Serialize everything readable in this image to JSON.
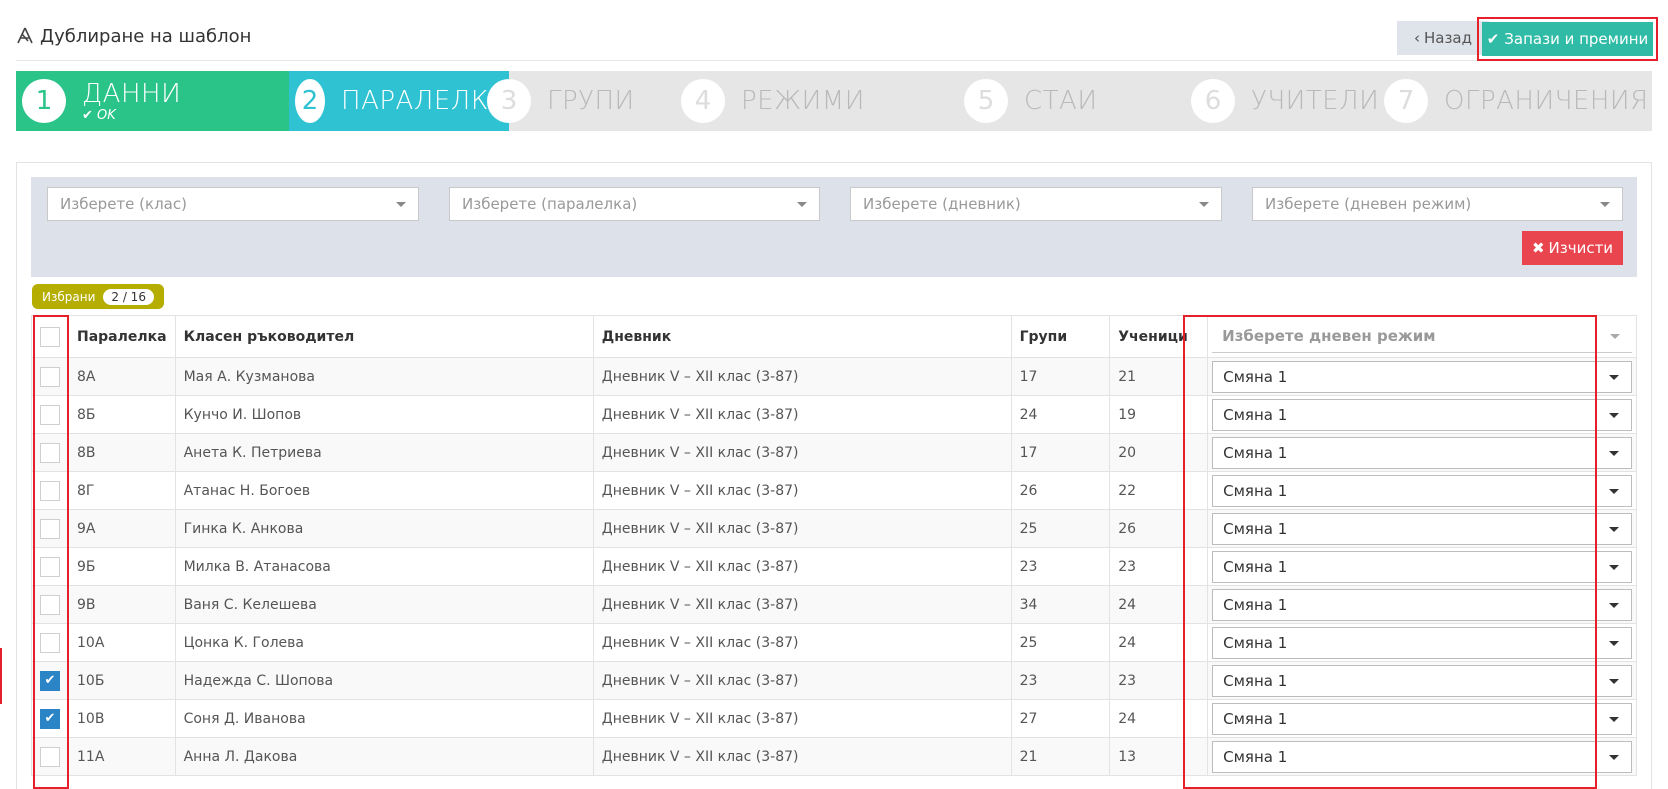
{
  "header": {
    "title": "Дублиране на шаблон",
    "back_label": "Назад",
    "save_label": "Запази и премини"
  },
  "wizard": {
    "steps": [
      {
        "number": "1",
        "label": "ДАННИ",
        "sub": "OK",
        "state": "done"
      },
      {
        "number": "2",
        "label": "ПАРАЛЕЛКИ",
        "state": "active"
      },
      {
        "number": "3",
        "label": "ГРУПИ",
        "state": "pending"
      },
      {
        "number": "4",
        "label": "РЕЖИМИ",
        "state": "pending"
      },
      {
        "number": "5",
        "label": "СТАИ",
        "state": "pending"
      },
      {
        "number": "6",
        "label": "УЧИТЕЛИ",
        "state": "pending"
      },
      {
        "number": "7",
        "label": "ОГРАНИЧЕНИЯ",
        "state": "pending"
      }
    ]
  },
  "filters": {
    "class_placeholder": "Изберете (клас)",
    "paralelka_placeholder": "Изберете (паралелка)",
    "diary_placeholder": "Изберете (дневник)",
    "mode_placeholder": "Изберете (дневен режим)",
    "clear_label": "Изчисти"
  },
  "selection": {
    "label": "Избрани",
    "count": "2 / 16"
  },
  "table": {
    "columns": [
      "Паралелка",
      "Класен ръководител",
      "Дневник",
      "Групи",
      "Ученици"
    ],
    "mode_header_placeholder": "Изберете дневен режим",
    "rows": [
      {
        "paralelka": "8А",
        "teacher": "Мая А. Кузманова",
        "diary": "Дневник V – XII клас (3-87)",
        "groups": "17",
        "students": "21",
        "mode": "Смяна 1",
        "checked": false
      },
      {
        "paralelka": "8Б",
        "teacher": "Кунчо И. Шопов",
        "diary": "Дневник V – XII клас (3-87)",
        "groups": "24",
        "students": "19",
        "mode": "Смяна 1",
        "checked": false
      },
      {
        "paralelka": "8В",
        "teacher": "Анета К. Петриева",
        "diary": "Дневник V – XII клас (3-87)",
        "groups": "17",
        "students": "20",
        "mode": "Смяна 1",
        "checked": false
      },
      {
        "paralelka": "8Г",
        "teacher": "Атанас Н. Богоев",
        "diary": "Дневник V – XII клас (3-87)",
        "groups": "26",
        "students": "22",
        "mode": "Смяна 1",
        "checked": false
      },
      {
        "paralelka": "9А",
        "teacher": "Гинка К. Анкова",
        "diary": "Дневник V – XII клас (3-87)",
        "groups": "25",
        "students": "26",
        "mode": "Смяна 1",
        "checked": false
      },
      {
        "paralelka": "9Б",
        "teacher": "Милка В. Атанасова",
        "diary": "Дневник V – XII клас (3-87)",
        "groups": "23",
        "students": "23",
        "mode": "Смяна 1",
        "checked": false
      },
      {
        "paralelka": "9В",
        "teacher": "Ваня С. Келешева",
        "diary": "Дневник V – XII клас (3-87)",
        "groups": "34",
        "students": "24",
        "mode": "Смяна 1",
        "checked": false
      },
      {
        "paralelka": "10А",
        "teacher": "Цонка К. Голева",
        "diary": "Дневник V – XII клас (3-87)",
        "groups": "25",
        "students": "24",
        "mode": "Смяна 1",
        "checked": false
      },
      {
        "paralelka": "10Б",
        "teacher": "Надежда С. Шопова",
        "diary": "Дневник V – XII клас (3-87)",
        "groups": "23",
        "students": "23",
        "mode": "Смяна 1",
        "checked": true
      },
      {
        "paralelka": "10В",
        "teacher": "Соня Д. Иванова",
        "diary": "Дневник V – XII клас (3-87)",
        "groups": "27",
        "students": "24",
        "mode": "Смяна 1",
        "checked": true
      },
      {
        "paralelka": "11А",
        "teacher": "Анна Л. Дакова",
        "diary": "Дневник V – XII клас (3-87)",
        "groups": "21",
        "students": "13",
        "mode": "Смяна 1",
        "checked": false
      }
    ]
  }
}
